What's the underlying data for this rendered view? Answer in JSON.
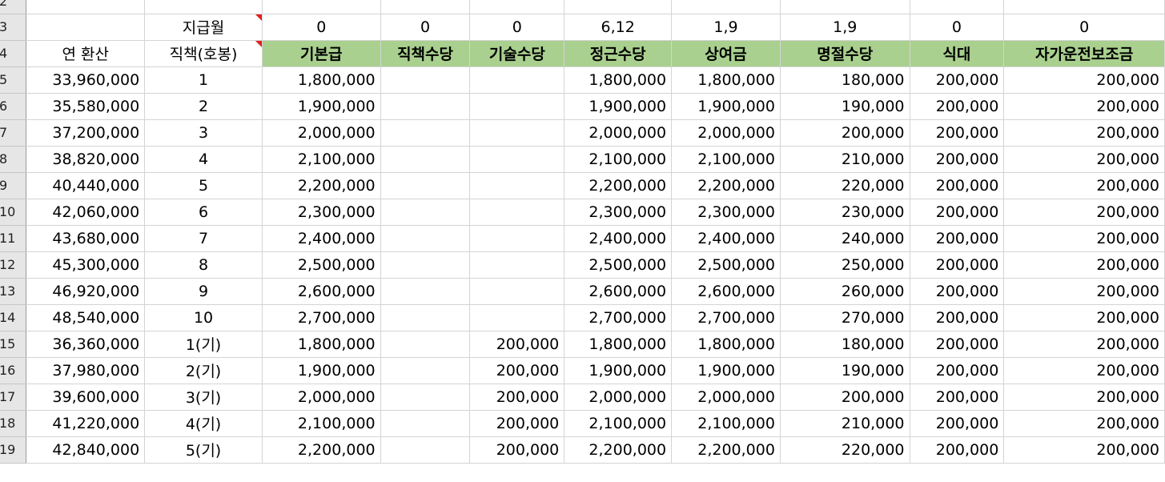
{
  "colors": {
    "header_fill": "#a9d08e",
    "comment_marker": "#e02020",
    "row_header_fill": "#e6e6e6"
  },
  "row_numbers": [
    "2",
    "3",
    "4",
    "5",
    "6",
    "7",
    "8",
    "9",
    "10",
    "11",
    "12",
    "13",
    "14",
    "15",
    "16",
    "17",
    "18",
    "19"
  ],
  "row3": {
    "label": "지급월",
    "values": [
      "0",
      "0",
      "0",
      "6,12",
      "1,9",
      "1,9",
      "0",
      "0"
    ]
  },
  "row4": {
    "annual_label": "연 환산",
    "position_label": "직책(호봉)",
    "headers": [
      "기본급",
      "직책수당",
      "기술수당",
      "정근수당",
      "상여금",
      "명절수당",
      "식대",
      "자가운전보조금"
    ]
  },
  "data_rows": [
    [
      "33,960,000",
      "1",
      "1,800,000",
      "",
      "",
      "1,800,000",
      "1,800,000",
      "180,000",
      "200,000",
      "200,000"
    ],
    [
      "35,580,000",
      "2",
      "1,900,000",
      "",
      "",
      "1,900,000",
      "1,900,000",
      "190,000",
      "200,000",
      "200,000"
    ],
    [
      "37,200,000",
      "3",
      "2,000,000",
      "",
      "",
      "2,000,000",
      "2,000,000",
      "200,000",
      "200,000",
      "200,000"
    ],
    [
      "38,820,000",
      "4",
      "2,100,000",
      "",
      "",
      "2,100,000",
      "2,100,000",
      "210,000",
      "200,000",
      "200,000"
    ],
    [
      "40,440,000",
      "5",
      "2,200,000",
      "",
      "",
      "2,200,000",
      "2,200,000",
      "220,000",
      "200,000",
      "200,000"
    ],
    [
      "42,060,000",
      "6",
      "2,300,000",
      "",
      "",
      "2,300,000",
      "2,300,000",
      "230,000",
      "200,000",
      "200,000"
    ],
    [
      "43,680,000",
      "7",
      "2,400,000",
      "",
      "",
      "2,400,000",
      "2,400,000",
      "240,000",
      "200,000",
      "200,000"
    ],
    [
      "45,300,000",
      "8",
      "2,500,000",
      "",
      "",
      "2,500,000",
      "2,500,000",
      "250,000",
      "200,000",
      "200,000"
    ],
    [
      "46,920,000",
      "9",
      "2,600,000",
      "",
      "",
      "2,600,000",
      "2,600,000",
      "260,000",
      "200,000",
      "200,000"
    ],
    [
      "48,540,000",
      "10",
      "2,700,000",
      "",
      "",
      "2,700,000",
      "2,700,000",
      "270,000",
      "200,000",
      "200,000"
    ],
    [
      "36,360,000",
      "1(기)",
      "1,800,000",
      "",
      "200,000",
      "1,800,000",
      "1,800,000",
      "180,000",
      "200,000",
      "200,000"
    ],
    [
      "37,980,000",
      "2(기)",
      "1,900,000",
      "",
      "200,000",
      "1,900,000",
      "1,900,000",
      "190,000",
      "200,000",
      "200,000"
    ],
    [
      "39,600,000",
      "3(기)",
      "2,000,000",
      "",
      "200,000",
      "2,000,000",
      "2,000,000",
      "200,000",
      "200,000",
      "200,000"
    ],
    [
      "41,220,000",
      "4(기)",
      "2,100,000",
      "",
      "200,000",
      "2,100,000",
      "2,100,000",
      "210,000",
      "200,000",
      "200,000"
    ],
    [
      "42,840,000",
      "5(기)",
      "2,200,000",
      "",
      "200,000",
      "2,200,000",
      "2,200,000",
      "220,000",
      "200,000",
      "200,000"
    ]
  ]
}
